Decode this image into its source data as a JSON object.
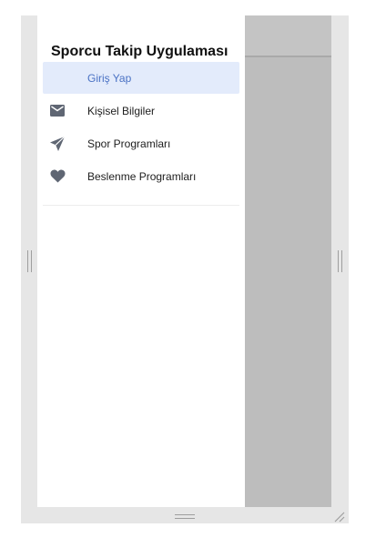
{
  "drawer": {
    "title": "Sporcu Takip Uygulaması",
    "items": [
      {
        "label": "Giriş Yap",
        "icon": "none",
        "active": true
      },
      {
        "label": "Kişisel Bilgiler",
        "icon": "mail-icon",
        "active": false
      },
      {
        "label": "Spor Programları",
        "icon": "send-icon",
        "active": false
      },
      {
        "label": "Beslenme Programları",
        "icon": "heart-icon",
        "active": false
      }
    ]
  },
  "colors": {
    "active_item_background": "#e3ebfb",
    "active_item_text": "#4a72c4",
    "icon": "#5f6673",
    "scrim": "#bdbdbd"
  }
}
